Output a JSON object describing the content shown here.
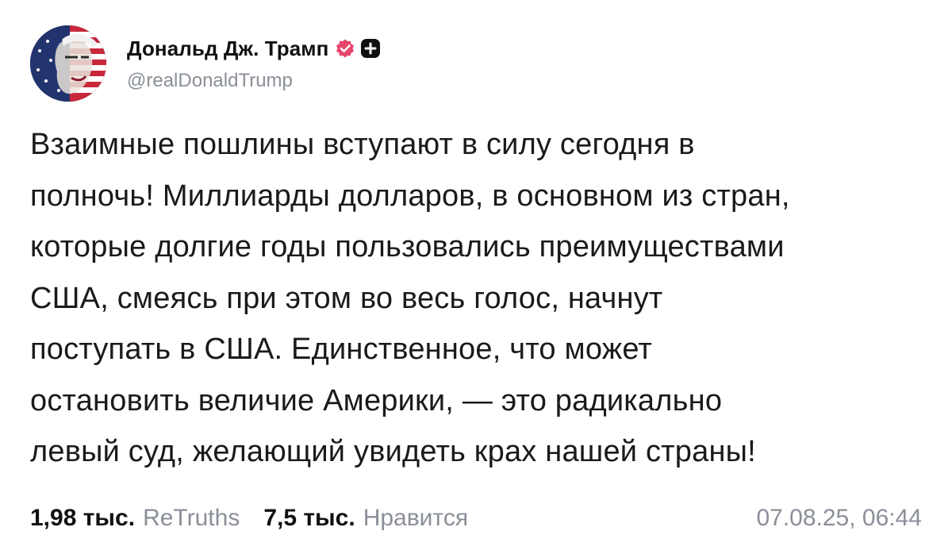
{
  "author": {
    "display_name": "Дональд Дж. Трамп",
    "handle": "@realDonaldTrump",
    "verified_icon": "verified-check-icon",
    "plus_icon": "plus-badge-icon",
    "colors": {
      "verified_badge": "#e8456b",
      "plus_badge": "#111111"
    }
  },
  "post": {
    "lines": [
      "Взаимные пошлины вступают в силу сегодня в",
      "полночь! Миллиарды долларов, в основном из стран,",
      "которые долгие годы пользовались преимуществами",
      "США, смеясь при этом во весь голос, начнут",
      "поступать в США. Единственное, что может",
      "остановить величие Америки, — это радикально",
      "левый суд, желающий увидеть крах нашей страны!"
    ]
  },
  "stats": {
    "retruths_count": "1,98 тыс.",
    "retruths_label": "ReTruths",
    "likes_count": "7,5 тыс.",
    "likes_label": "Нравится",
    "timestamp": "07.08.25, 06:44"
  }
}
